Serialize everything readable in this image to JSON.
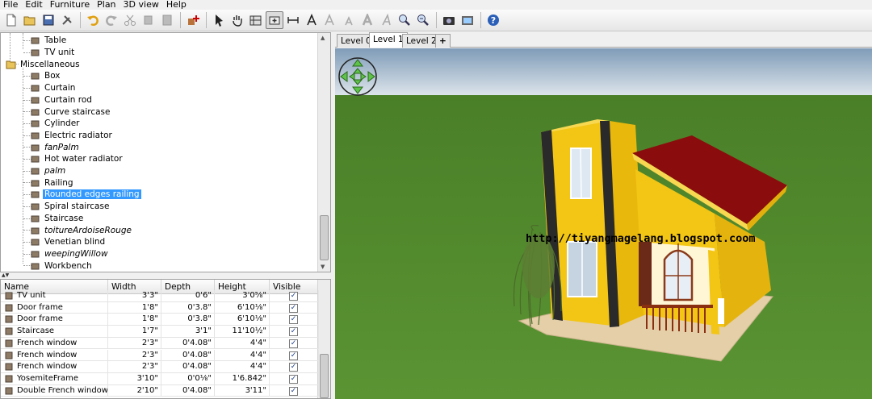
{
  "menu": [
    "File",
    "Edit",
    "Furniture",
    "Plan",
    "3D view",
    "Help"
  ],
  "toolbar": {
    "icons": [
      "new-icon",
      "open-icon",
      "save-icon",
      "preferences-icon",
      "undo-icon",
      "redo-icon",
      "cut-icon",
      "copy-icon",
      "paste-icon",
      "add-furniture-icon",
      "select-icon",
      "pan-icon",
      "create-walls-icon",
      "create-rooms-icon",
      "create-dimensions-icon",
      "add-text-icon",
      "increase-text-icon",
      "decrease-text-icon",
      "bold-text-icon",
      "italic-text-icon",
      "zoom-in-icon",
      "zoom-out-icon",
      "create-photo-icon",
      "create-video-icon",
      "help-icon"
    ]
  },
  "catalog": {
    "items": [
      {
        "label": "Table",
        "icon": "table-icon",
        "italic": false,
        "depth": 2
      },
      {
        "label": "TV unit",
        "icon": "tv-unit-icon",
        "italic": false,
        "depth": 2
      },
      {
        "label": "Miscellaneous",
        "icon": "folder-icon",
        "italic": false,
        "depth": 1
      },
      {
        "label": "Box",
        "icon": "box-icon",
        "italic": false,
        "depth": 2
      },
      {
        "label": "Curtain",
        "icon": "curtain-icon",
        "italic": false,
        "depth": 2
      },
      {
        "label": "Curtain rod",
        "icon": "curtain-rod-icon",
        "italic": false,
        "depth": 2
      },
      {
        "label": "Curve staircase",
        "icon": "curve-staircase-icon",
        "italic": false,
        "depth": 2
      },
      {
        "label": "Cylinder",
        "icon": "cylinder-icon",
        "italic": false,
        "depth": 2
      },
      {
        "label": "Electric radiator",
        "icon": "electric-radiator-icon",
        "italic": false,
        "depth": 2
      },
      {
        "label": "fanPalm",
        "icon": "fan-palm-icon",
        "italic": true,
        "depth": 2
      },
      {
        "label": "Hot water radiator",
        "icon": "hot-water-radiator-icon",
        "italic": false,
        "depth": 2
      },
      {
        "label": "palm",
        "icon": "palm-icon",
        "italic": true,
        "depth": 2
      },
      {
        "label": "Railing",
        "icon": "railing-icon",
        "italic": false,
        "depth": 2
      },
      {
        "label": "Rounded edges railing",
        "icon": "rounded-railing-icon",
        "italic": false,
        "depth": 2,
        "selected": true
      },
      {
        "label": "Spiral staircase",
        "icon": "spiral-staircase-icon",
        "italic": false,
        "depth": 2
      },
      {
        "label": "Staircase",
        "icon": "staircase-icon",
        "italic": false,
        "depth": 2
      },
      {
        "label": "toitureArdoiseRouge",
        "icon": "roof-icon",
        "italic": true,
        "depth": 2
      },
      {
        "label": "Venetian blind",
        "icon": "venetian-blind-icon",
        "italic": false,
        "depth": 2
      },
      {
        "label": "weepingWillow",
        "icon": "willow-icon",
        "italic": true,
        "depth": 2
      },
      {
        "label": "Workbench",
        "icon": "workbench-icon",
        "italic": false,
        "depth": 2
      }
    ]
  },
  "furniture_table": {
    "headers": [
      "Name",
      "Width",
      "Depth",
      "Height",
      "Visible"
    ],
    "rows": [
      {
        "name": "TV unit",
        "width": "3'3\"",
        "depth": "0'6\"",
        "height": "3'0⅝\"",
        "visible": true,
        "icon": "tv-unit-icon"
      },
      {
        "name": "Door frame",
        "width": "1'8\"",
        "depth": "0'3.8\"",
        "height": "6'10⅛\"",
        "visible": true,
        "icon": "door-frame-icon"
      },
      {
        "name": "Door frame",
        "width": "1'8\"",
        "depth": "0'3.8\"",
        "height": "6'10⅛\"",
        "visible": true,
        "icon": "door-frame-icon"
      },
      {
        "name": "Staircase",
        "width": "1'7\"",
        "depth": "3'1\"",
        "height": "11'10½\"",
        "visible": true,
        "icon": "staircase-icon"
      },
      {
        "name": "French window",
        "width": "2'3\"",
        "depth": "0'4.08\"",
        "height": "4'4\"",
        "visible": true,
        "icon": "french-window-icon"
      },
      {
        "name": "French window",
        "width": "2'3\"",
        "depth": "0'4.08\"",
        "height": "4'4\"",
        "visible": true,
        "icon": "french-window-icon"
      },
      {
        "name": "French window",
        "width": "2'3\"",
        "depth": "0'4.08\"",
        "height": "4'4\"",
        "visible": true,
        "icon": "french-window-icon"
      },
      {
        "name": "YosemiteFrame",
        "width": "3'10\"",
        "depth": "0'0⅛\"",
        "height": "1'6.842\"",
        "visible": true,
        "icon": "frame-icon"
      },
      {
        "name": "Double French window",
        "width": "2'10\"",
        "depth": "0'4.08\"",
        "height": "3'11\"",
        "visible": true,
        "icon": "double-french-window-icon"
      }
    ]
  },
  "levels": {
    "tabs": [
      "Level 0",
      "Level 1",
      "Level 2"
    ],
    "active": "Level 1",
    "add_label": "+"
  },
  "view3d": {
    "watermark": "http://tiyangmagelang.blogspot.coom",
    "colors": {
      "sky_top": "#7f9cb8",
      "sky_bottom": "#dfe6ec",
      "grass": "#4f8a2a",
      "wall": "#f3c514",
      "roof": "#8b0c0c"
    }
  }
}
